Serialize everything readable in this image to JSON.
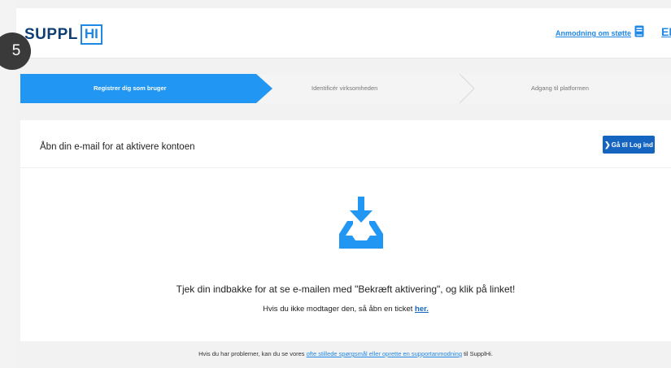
{
  "brand": {
    "logo_left": "SUPPL",
    "logo_right": "HI"
  },
  "badge": "5",
  "header": {
    "support_link": "Anmodning om støtte",
    "book_icon": "book-icon",
    "language": "EN"
  },
  "steps": [
    {
      "label": "Registrer dig som bruger",
      "active": true
    },
    {
      "label": "Identificér virksomheden",
      "active": false
    },
    {
      "label": "Adgang til platformen",
      "active": false
    }
  ],
  "card": {
    "title": "Åbn din e-mail for at aktivere kontoen",
    "login_button": "Gå til Log ind",
    "icon": "inbox-download-icon",
    "main_message": "Tjek din indbakke for at se e-mailen med \"Bekræft aktivering\", og klik på linket!",
    "sub_message_prefix": "Hvis du ikke modtager den, så åbn en ticket ",
    "sub_message_link": "her."
  },
  "footer": {
    "prefix": "Hvis du har problemer, kan du se vores ",
    "link": "ofte stillede spørgsmål eller oprette en supportanmodning",
    "suffix": " til SupplHi."
  },
  "colors": {
    "accent": "#2196f3",
    "brand_dark": "#0d3f74",
    "button": "#1565c0"
  }
}
